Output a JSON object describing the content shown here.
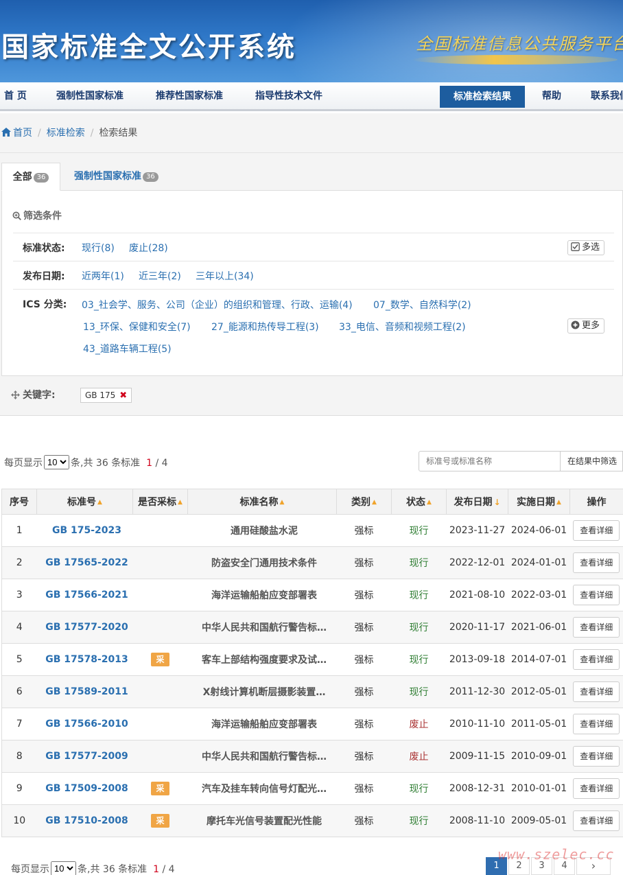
{
  "banner": {
    "title": "国家标准全文公开系统",
    "slogan": "全国标准信息公共服务平台"
  },
  "nav": {
    "items": [
      {
        "label": "首 页",
        "active": false
      },
      {
        "label": "强制性国家标准",
        "active": false
      },
      {
        "label": "推荐性国家标准",
        "active": false
      },
      {
        "label": "指导性技术文件",
        "active": false
      },
      {
        "label": "标准检索结果",
        "active": true
      },
      {
        "label": "帮助",
        "active": false
      },
      {
        "label": "联系我们",
        "active": false
      }
    ]
  },
  "breadcrumb": {
    "items": [
      "首页",
      "标准检索",
      "检索结果"
    ],
    "separator": "/"
  },
  "tabs": [
    {
      "label": "全部",
      "count": "36"
    },
    {
      "label": "强制性国家标准",
      "count": "36"
    }
  ],
  "filter": {
    "title": "筛选条件",
    "status": {
      "label": "标准状态:",
      "options": [
        "现行(8)",
        "废止(28)"
      ],
      "button": "多选"
    },
    "date": {
      "label": "发布日期:",
      "options": [
        "近两年(1)",
        "近三年(2)",
        "三年以上(34)"
      ]
    },
    "ics": {
      "label": "ICS 分类:",
      "options": [
        "03_社会学、服务、公司（企业）的组织和管理、行政、运输(4)",
        "07_数学、自然科学(2)",
        "13_环保、保健和安全(7)",
        "27_能源和热传导工程(3)",
        "33_电信、音频和视频工程(2)",
        "43_道路车辆工程(5)"
      ],
      "button": "更多"
    }
  },
  "keyword": {
    "label": "关键字:",
    "value": "GB 175",
    "remove": "✖"
  },
  "pager": {
    "prefix": "每页显示",
    "per_page": "10",
    "middle": "条,共",
    "total": "36",
    "suffix": "条标准",
    "current": "1",
    "sep": "/",
    "pages_total": "4",
    "pages": [
      "1",
      "2",
      "3",
      "4"
    ],
    "next": "›"
  },
  "search": {
    "placeholder": "标准号或标准名称",
    "button": "在结果中筛选"
  },
  "table": {
    "headers": [
      "序号",
      "标准号",
      "是否采标",
      "标准名称",
      "类别",
      "状态",
      "发布日期",
      "实施日期",
      "操作"
    ],
    "detail_label": "查看详细",
    "rows": [
      {
        "no": "1",
        "code": "GB 175-2023",
        "cai": "",
        "name": "通用硅酸盐水泥",
        "type": "强标",
        "status": "现行",
        "pub": "2023-11-27",
        "impl": "2024-06-01"
      },
      {
        "no": "2",
        "code": "GB 17565-2022",
        "cai": "",
        "name": "防盗安全门通用技术条件",
        "type": "强标",
        "status": "现行",
        "pub": "2022-12-01",
        "impl": "2024-01-01"
      },
      {
        "no": "3",
        "code": "GB 17566-2021",
        "cai": "",
        "name": "海洋运输船舶应变部署表",
        "type": "强标",
        "status": "现行",
        "pub": "2021-08-10",
        "impl": "2022-03-01"
      },
      {
        "no": "4",
        "code": "GB 17577-2020",
        "cai": "",
        "name": "中华人民共和国航行警告标…",
        "type": "强标",
        "status": "现行",
        "pub": "2020-11-17",
        "impl": "2021-06-01"
      },
      {
        "no": "5",
        "code": "GB 17578-2013",
        "cai": "采",
        "name": "客车上部结构强度要求及试…",
        "type": "强标",
        "status": "现行",
        "pub": "2013-09-18",
        "impl": "2014-07-01"
      },
      {
        "no": "6",
        "code": "GB 17589-2011",
        "cai": "",
        "name": "X射线计算机断层摄影装置…",
        "type": "强标",
        "status": "现行",
        "pub": "2011-12-30",
        "impl": "2012-05-01"
      },
      {
        "no": "7",
        "code": "GB 17566-2010",
        "cai": "",
        "name": "海洋运输船舶应变部署表",
        "type": "强标",
        "status": "废止",
        "pub": "2010-11-10",
        "impl": "2011-05-01"
      },
      {
        "no": "8",
        "code": "GB 17577-2009",
        "cai": "",
        "name": "中华人民共和国航行警告标…",
        "type": "强标",
        "status": "废止",
        "pub": "2009-11-15",
        "impl": "2010-09-01"
      },
      {
        "no": "9",
        "code": "GB 17509-2008",
        "cai": "采",
        "name": "汽车及挂车转向信号灯配光…",
        "type": "强标",
        "status": "现行",
        "pub": "2008-12-31",
        "impl": "2010-01-01"
      },
      {
        "no": "10",
        "code": "GB 17510-2008",
        "cai": "采",
        "name": "摩托车光信号装置配光性能",
        "type": "强标",
        "status": "现行",
        "pub": "2008-11-10",
        "impl": "2009-05-01"
      }
    ]
  },
  "watermark": "www.szelec.cc",
  "colors": {
    "primary": "#1d5d9f",
    "link": "#2a6fb0",
    "current_page": "#d0021b",
    "cai_badge": "#f0a545",
    "status_ok": "#2e7d32",
    "status_no": "#a33333"
  }
}
